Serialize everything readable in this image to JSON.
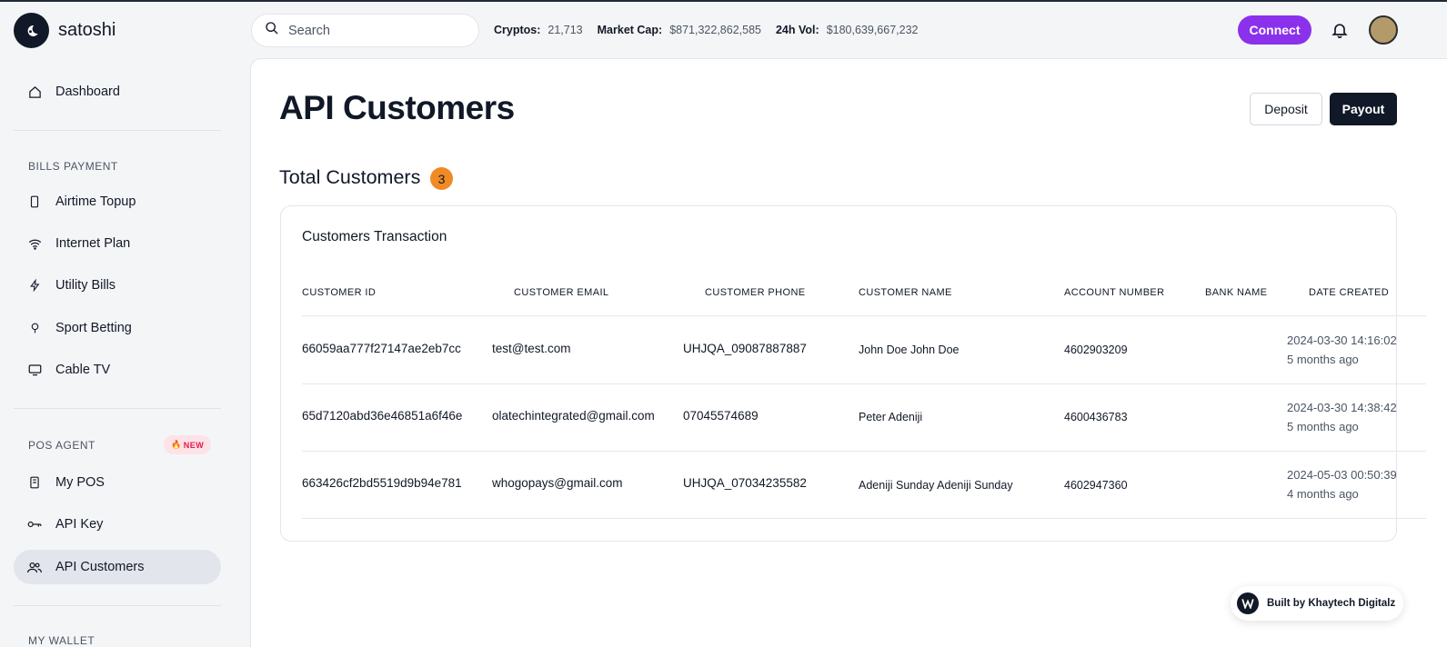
{
  "brand": {
    "name": "satoshi"
  },
  "search": {
    "placeholder": "Search"
  },
  "stats": [
    {
      "label": "Cryptos:",
      "value": "21,713"
    },
    {
      "label": "Market Cap:",
      "value": "$871,322,862,585"
    },
    {
      "label": "24h Vol:",
      "value": "$180,639,667,232"
    }
  ],
  "header": {
    "connect_label": "Connect"
  },
  "sidebar": {
    "dashboard": "Dashboard",
    "bills_section": "BILLS PAYMENT",
    "airtime": "Airtime Topup",
    "internet": "Internet Plan",
    "utility": "Utility Bills",
    "sport": "Sport Betting",
    "cable": "Cable TV",
    "pos_section": "POS AGENT",
    "new_badge": "NEW",
    "my_pos": "My POS",
    "api_key": "API Key",
    "api_customers": "API Customers",
    "wallet_section": "MY WALLET"
  },
  "page": {
    "title": "API Customers",
    "deposit_label": "Deposit",
    "payout_label": "Payout",
    "total_label": "Total Customers",
    "total_count": "3",
    "card_title": "Customers Transaction"
  },
  "table": {
    "columns": [
      "CUSTOMER ID",
      "CUSTOMER EMAIL",
      "CUSTOMER PHONE",
      "CUSTOMER NAME",
      "ACCOUNT NUMBER",
      "BANK NAME",
      "DATE CREATED"
    ],
    "rows": [
      {
        "id": "66059aa777f27147ae2eb7cc",
        "email": "test@test.com",
        "phone": "UHJQA_09087887887",
        "name": "John Doe John Doe",
        "account": "4602903209",
        "bank": "",
        "date": "2024-03-30 14:16:02",
        "ago": "5 months ago"
      },
      {
        "id": "65d7120abd36e46851a6f46e",
        "email": "olatechintegrated@gmail.com",
        "phone": "07045574689",
        "name": "Peter Adeniji",
        "account": "4600436783",
        "bank": "",
        "date": "2024-03-30 14:38:42",
        "ago": "5 months ago"
      },
      {
        "id": "663426cf2bd5519d9b94e781",
        "email": "whogopays@gmail.com",
        "phone": "UHJQA_07034235582",
        "name": "Adeniji Sunday Adeniji Sunday",
        "account": "4602947360",
        "bank": "",
        "date": "2024-05-03 00:50:39",
        "ago": "4 months ago"
      }
    ]
  },
  "footer": {
    "built_by": "Built by Khaytech Digitalz"
  },
  "colors": {
    "accent": "#8b31ec",
    "badge": "#f08a24",
    "dark": "#111827"
  }
}
